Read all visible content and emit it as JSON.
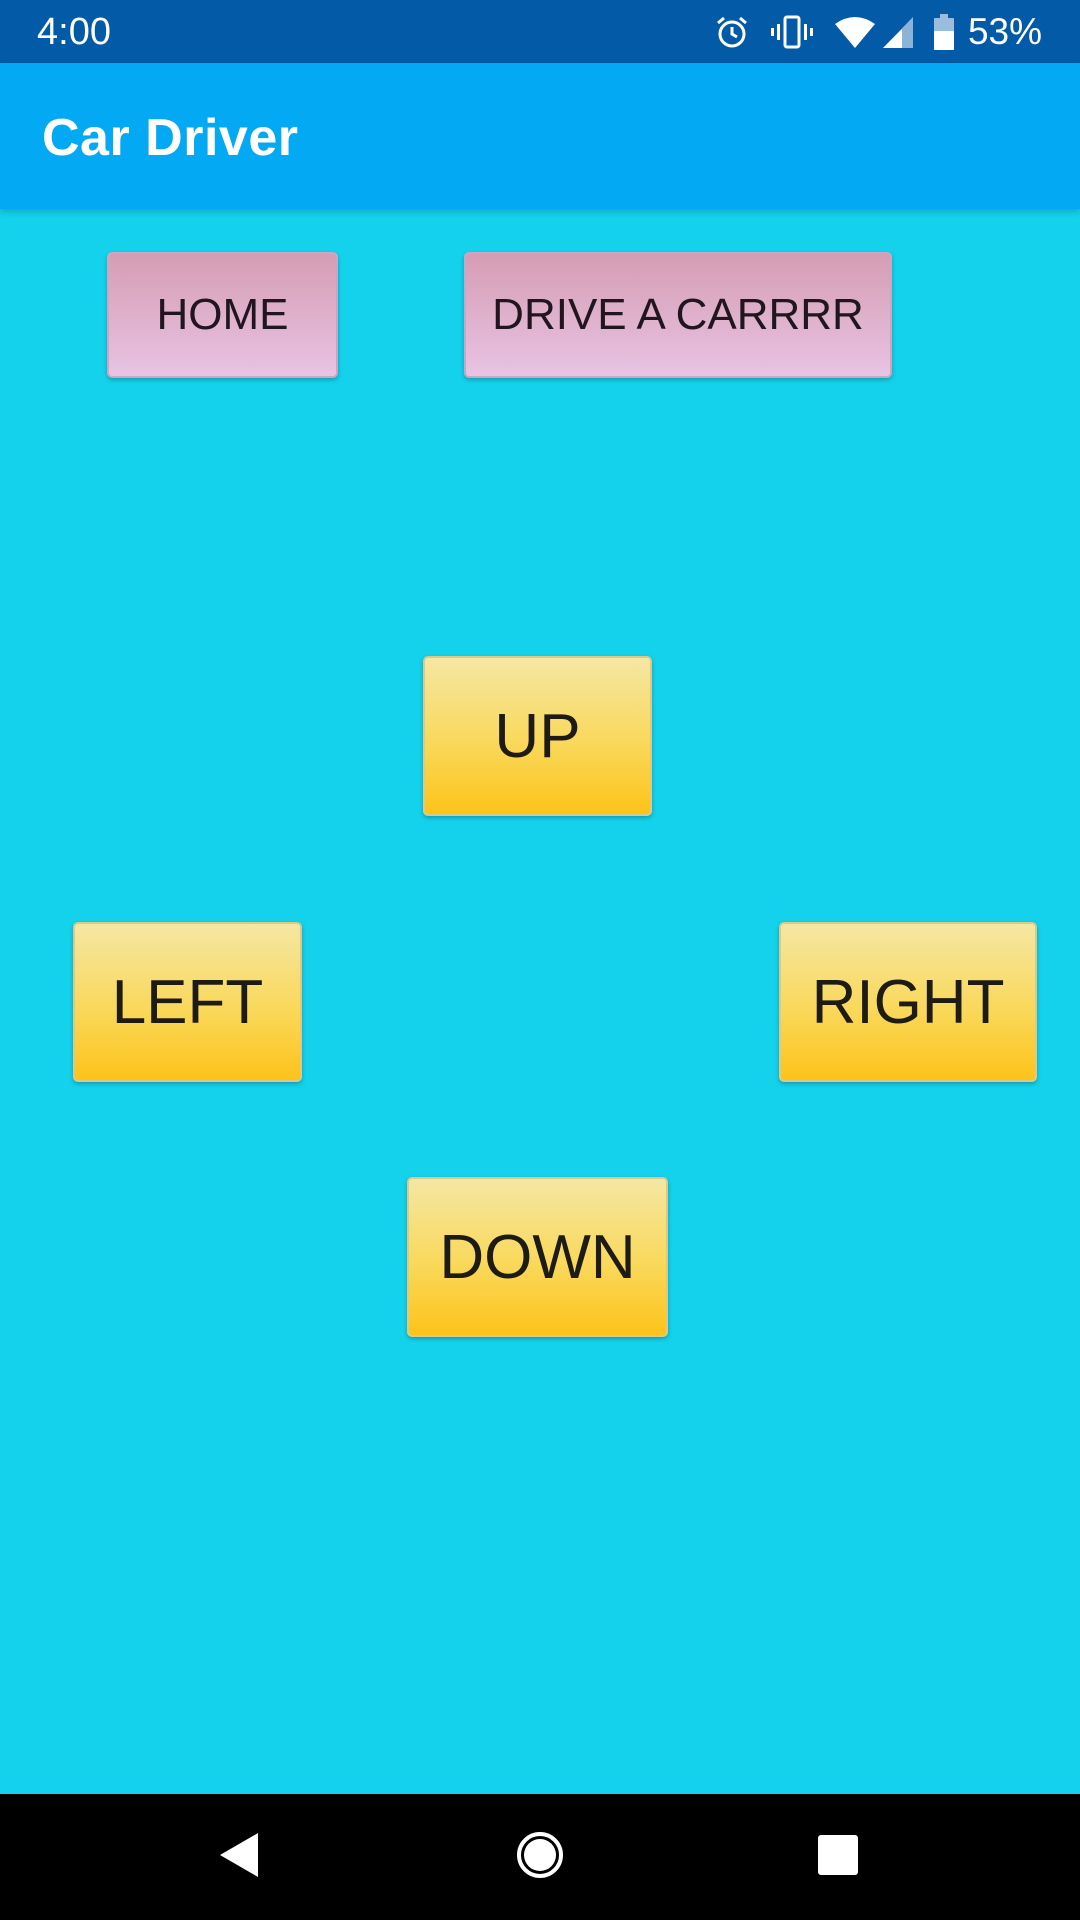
{
  "status_bar": {
    "time": "4:00",
    "battery_percent": "53%",
    "icons": [
      "alarm-icon",
      "vibrate-icon",
      "wifi-icon",
      "cell-signal-icon",
      "battery-icon"
    ]
  },
  "app_bar": {
    "title": "Car Driver"
  },
  "top_buttons": {
    "home_label": "HOME",
    "drive_label": "DRIVE A CARRRR"
  },
  "controls": {
    "up_label": "UP",
    "left_label": "LEFT",
    "right_label": "RIGHT",
    "down_label": "DOWN"
  },
  "nav_bar": {
    "icons": [
      "back-icon",
      "home-circle-icon",
      "recents-icon"
    ]
  },
  "colors": {
    "status_bar": "#035aa6",
    "app_bar": "#03a9f3",
    "background": "#14d2ec",
    "pink_button_top": "#d59db3",
    "pink_button_bottom": "#e8c3e3",
    "yellow_button_top": "#f5e7a4",
    "yellow_button_bottom": "#fdc31a"
  }
}
